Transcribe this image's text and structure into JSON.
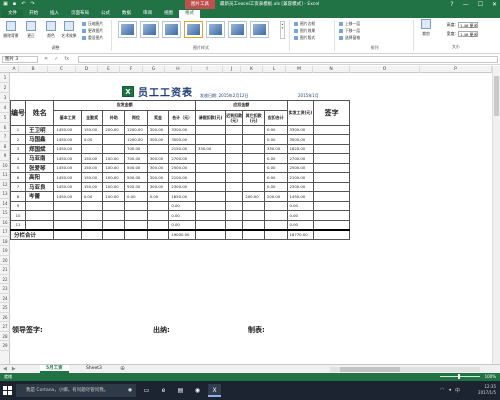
{
  "window": {
    "title": "最新员工excel工资表模板.xls [兼容模式] - Excel",
    "context_tab_group": "图片工具",
    "controls": [
      "?",
      "—",
      "☐",
      "✕"
    ]
  },
  "ribbon_tabs": [
    "文件",
    "开始",
    "插入",
    "页面布局",
    "公式",
    "数据",
    "审阅",
    "视图",
    "格式"
  ],
  "ribbon": {
    "adjust": {
      "remove_bg": "删除背景",
      "corrections": "更正",
      "color": "颜色",
      "artistic": "艺术效果"
    },
    "small_left": [
      "压缩图片",
      "更改图片",
      "重设图片"
    ],
    "adjust_label": "调整",
    "styles_label": "图片样式",
    "right_col1": [
      "图片边框",
      "图片效果",
      "图片版式"
    ],
    "right_col2": [
      "上移一层",
      "下移一层",
      "选择窗格"
    ],
    "arrange_label": "排列",
    "size": {
      "height_label": "高度:",
      "height_value": "1.48 厘米",
      "width_label": "宽度:",
      "width_value": "1.48 厘米",
      "label": "大小",
      "crop": "裁剪"
    }
  },
  "formula_bar": {
    "name_box": "图片 3",
    "fx": "fx",
    "value": ""
  },
  "columns": [
    "A",
    "B",
    "C",
    "D",
    "E",
    "F",
    "G",
    "H",
    "I",
    "J",
    "K",
    "L",
    "M",
    "N",
    "O",
    "P"
  ],
  "rows": [
    "1",
    "2",
    "3",
    "4",
    "5",
    "6",
    "7",
    "8",
    "9",
    "10",
    "11",
    "12",
    "13",
    "14",
    "15",
    "16",
    "17",
    "18",
    "19",
    "20",
    "21",
    "22",
    "23",
    "24",
    "25",
    "26",
    "27",
    "28",
    "29"
  ],
  "payroll": {
    "title": "员工工资表",
    "date_text": "发放日期: 2015年2月12日",
    "month_text": "2015年1月",
    "header": {
      "no": "编号",
      "name": "姓名",
      "payable_group": "应发金额",
      "deduct_group": "应扣金额",
      "actual": "实发工资(元)",
      "signature": "签字",
      "cols": [
        "基本工资",
        "全勤奖",
        "补助",
        "岗位",
        "奖金",
        "合计（元）",
        "请假扣款(元)",
        "迟到扣款(元)",
        "其它扣款(元)",
        "应扣合计"
      ]
    },
    "rows": [
      {
        "no": "1",
        "name": "王卫明",
        "vals": [
          "1450.00",
          "150.00",
          "200.00",
          "1200.00",
          "300.00",
          "3300.00",
          "",
          "",
          "",
          "0.00",
          "3300.00"
        ]
      },
      {
        "no": "2",
        "name": "马国鑫",
        "vals": [
          "1450.00",
          "0.00",
          "",
          "1200.00",
          "300.00",
          "3000.00",
          "",
          "",
          "",
          "0.00",
          "3000.00"
        ]
      },
      {
        "no": "3",
        "name": "郑国斌",
        "vals": [
          "1450.00",
          "",
          "",
          "700.00",
          "",
          "2150.00",
          "330.00",
          "",
          "",
          "330.00",
          "1820.00"
        ]
      },
      {
        "no": "4",
        "name": "马亚南",
        "vals": [
          "1450.00",
          "150.00",
          "100.00",
          "700.00",
          "300.00",
          "2700.00",
          "",
          "",
          "",
          "0.00",
          "2700.00"
        ]
      },
      {
        "no": "5",
        "name": "张爱琴",
        "vals": [
          "1450.00",
          "150.00",
          "100.00",
          "500.00",
          "300.00",
          "2500.00",
          "",
          "",
          "",
          "0.00",
          "2500.00"
        ]
      },
      {
        "no": "6",
        "name": "高阳",
        "vals": [
          "1450.00",
          "150.00",
          "100.00",
          "500.00",
          "300.00",
          "2100.00",
          "",
          "",
          "",
          "0.00",
          "2100.00"
        ]
      },
      {
        "no": "7",
        "name": "马亚良",
        "vals": [
          "1450.00",
          "150.00",
          "100.00",
          "500.00",
          "300.00",
          "2300.00",
          "",
          "",
          "",
          "0.00",
          "2300.00"
        ]
      },
      {
        "no": "8",
        "name": "岑蕾",
        "vals": [
          "1450.00",
          "0.00",
          "100.00",
          "0.00",
          "0.00",
          "1650.00",
          "",
          "",
          "200.00",
          "200.00",
          "1450.00"
        ]
      },
      {
        "no": "9",
        "name": "",
        "vals": [
          "",
          "",
          "",
          "",
          "",
          "0.00",
          "",
          "",
          "",
          "",
          "0.00"
        ]
      },
      {
        "no": "10",
        "name": "",
        "vals": [
          "",
          "",
          "",
          "",
          "",
          "0.00",
          "",
          "",
          "",
          "",
          "0.00"
        ]
      },
      {
        "no": "11",
        "name": "",
        "vals": [
          "",
          "",
          "",
          "",
          "",
          "0.00",
          "",
          "",
          "",
          "",
          "0.00"
        ]
      }
    ],
    "total": {
      "label": "分栏合计",
      "sum": "19000.00",
      "actual": "18770.00"
    },
    "signs": {
      "leader": "领导签字:",
      "cashier": "出纳:",
      "preparer": "制表:"
    }
  },
  "sheet_tabs": [
    "5月工资",
    "Sheet3"
  ],
  "status": {
    "ready": "就绪",
    "zoom": "100%"
  },
  "taskbar": {
    "cortana": "我是 Cortana，小娜。有问题尽管问我。",
    "icons": [
      "▭",
      "e",
      "▤",
      "◉",
      "X"
    ],
    "time": "12:35",
    "date": "2017/1/5"
  }
}
